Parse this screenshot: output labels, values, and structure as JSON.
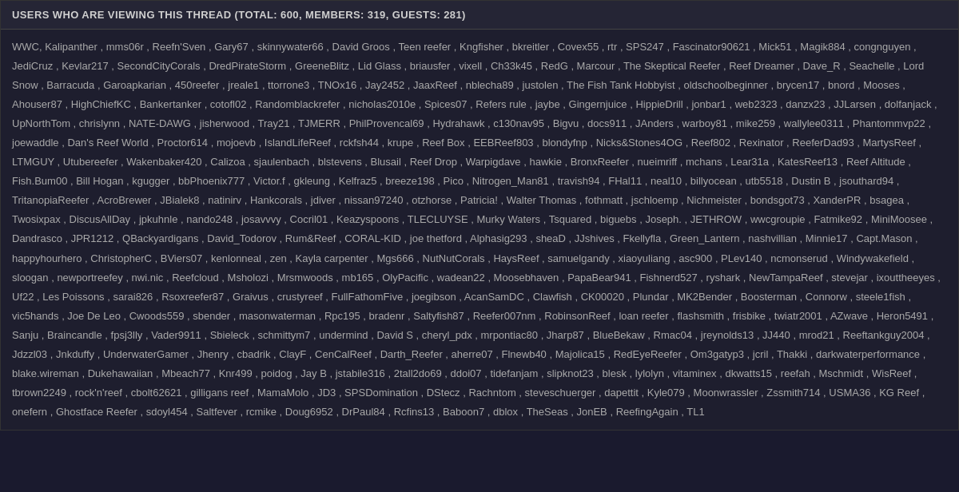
{
  "header": {
    "title": "USERS WHO ARE VIEWING THIS THREAD (TOTAL: 600, MEMBERS: 319, GUESTS: 281)"
  },
  "users": {
    "text": "WWC, Kalipanther, mms06r, Reefn'Sven, Gary67, skinnywater66, David Groos, Teen reefer, Kngfisher, bkreitler, Covex55, rtr, SPS247, Fascinator90621, Mick51, Magik884, congnguyen, JediCruz, Kevlar217, SecondCityCorals, DredPirateStorm, GreeneBlitz, Lid Glass, briausfer, vixell, Ch33k45, RedG, Marcour, The Skeptical Reefer, Reef Dreamer, Dave_R, Seachelle, Lord Snow, Barracuda, Garoapkarian, 450reefer, jreale1, ttorrone3, TNOx16, Jay2452, JaaxReef, nblecha89, justolen, The Fish Tank Hobbyist, oldschoolbeginner, brycen17, bnord, Mooses, Ahouser87, HighChiefKC, Bankertanker, cotofl02, Randomblackrefer, nicholas2010e, Spices07, Refers rule, jaybe, Gingernjuice, HippieDrill, jonbar1, web2323, danzx23, JJLarsen, dolfanjack, UpNorthTom, chrislynn, NATE-DAWG, jisherwood, Tray21, TJMERR, PhilProvencal69, Hydrahawk, c130nav95, Bigvu, docs911, JAnders, warboy81, mike259, wallylee0311, Phantommvp22, joewaddle, Dan's Reef World, Proctor614, mojoevb, IslandLifeReef, rckfsh44, krupe, Reef Box, EEBReef803, blondyfnp, Nicks&Stones4OG, Reef802, Rexinator, ReeferDad93, MartysReef, LTMGUY, Utubereefer, Wakenbaker420, Calizoa, sjaulenbach, blstevens, Blusail, Reef Drop, Warpigdave, hawkie, BronxReefer, nueimriff, mchans, Lear31a, KatesReef13, Reef Altitude, Fish.Bum00, Bill Hogan, kgugger, bbPhoenix777, Victor.f, gkleung, Kelfraz5, breeze198, Pico, Nitrogen_Man81, travish94, FHal11, neal10, billyocean, utb5518, Dustin B, jsouthard94, TritanopiaReefer, AcroBrewer, JBialek8, natinirv, Hankcorals, jdiver, nissan97240, otzhorse, Patricia!, Walter Thomas, fothmatt, jschloemp, Nichmeister, bondsgot73, XanderPR, bsagea, Twosixpax, DiscusAllDay, jpkuhnle, nando248, josavvvy, Cocril01, Keazyspoons, TLECLUYSE, Murky Waters, Tsquared, biguebs, Joseph., JETHROW, wwcgroupie, Fatmike92, MiniMoosee, Dandrasco, JPR1212, QBackyardigans, David_Todorov, Rum&Reef, CORAL-KID, joe thetford, Alphasig293, sheaD, JJshives, Fkellyfla, Green_Lantern, nashvillian, Minnie17, Capt.Mason, happyhourhero, ChristopherC, BViers07, kenlonneal, zen, Kayla carpenter, Mgs666, NutNutCorals, HaysReef, samuelgandy, xiaoyuliang, asc900, PLev140, ncmonserud, Windywakefield, sloogan, newportreefey, nwi.nic, Reefcloud, Msholozi, Mrsmwoods, mb165, OlyPacific, wadean22, Moosebhaven, PapaBear941, Fishnerd527, ryshark, NewTampaReef, stevejar, ixouttheeyes, Uf22, Les Poissons, sarai826, Rsoxreefer87, Graivus, crustyreef, FullFathomFive, joegibson, AcanSamDC, Clawfish, CK00020, Plundar, MK2Bender, Boosterman, Connorw, steele1fish, vic5hands, Joe De Leo, Cwoods559, sbender, masonwaterman, Rpc195, bradenr, Saltyfish87, Reefer007nm, RobinsonReef, loan reefer, flashsmith, frisbike, twiatr2001, AZwave, Heron5491, Sanju, Braincandle, fpsj3lly, Vader9911, Sbieleck, schmittym7, undermind, David S, cheryl_pdx, mrpontiac80, Jharp87, BlueBekaw, Rmac04, jreynolds13, JJ440, mrod21, Reeftankguy2004, Jdzzl03, Jnkduffy, UnderwaterGamer, Jhenry, cbadrik, ClayF, CenCalReef, Darth_Reefer, aherre07, Flnewb40, Majolica15, RedEyeReefer, Om3gatyp3, jcril, Thakki, darkwaterperformance, blake.wireman, Dukehawaiian, Mbeach77, Knr499, poidog, Jay B, jstabile316, 2tall2do69, ddoi07, tidefanjam, slipknot23, blesk, lylolyn, vitaminex, dkwatts15, reefah, Mschmidt, WisReef, tbrown2249, rock'n'reef, cbolt62621, gilligans reef, MamaMolo, JD3, SPSDomination, DStecz, Rachntom, steveschuerger, dapettit, Kyle079, Moonwrassler, Zssmith714, USMA36, KG Reef, onefern, Ghostface Reefer, sdoyl454, Saltfever, rcmike, Doug6952, DrPaul84, Rcfins13, Baboon7, dblox, TheSeas, JonEB, ReefingAgain, TL1"
  }
}
